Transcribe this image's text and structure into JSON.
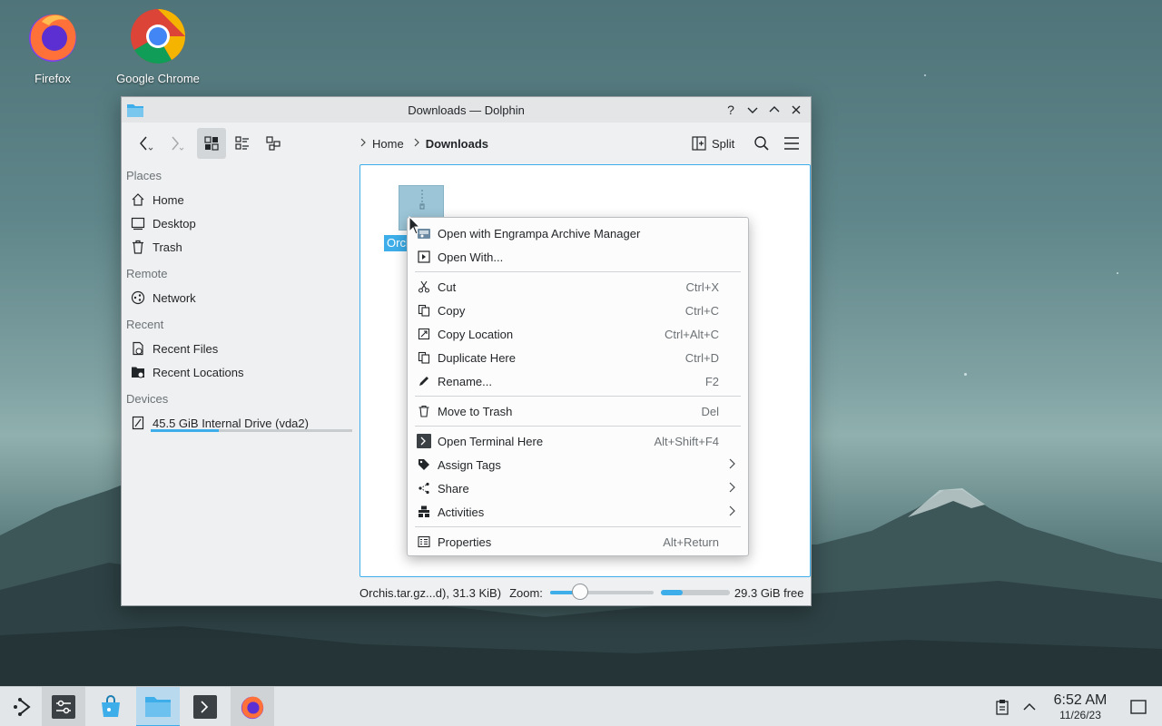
{
  "desktop": {
    "icons": [
      {
        "label": "Firefox",
        "icon": "firefox-icon"
      },
      {
        "label": "Google Chrome",
        "icon": "chrome-icon"
      }
    ]
  },
  "window": {
    "title": "Downloads — Dolphin",
    "title_buttons": {
      "help": "?",
      "minimize": "⌄",
      "maximize": "⌃",
      "close": "✕"
    }
  },
  "toolbar": {
    "breadcrumb": [
      {
        "label": "Home"
      },
      {
        "label": "Downloads"
      }
    ],
    "split_label": "Split"
  },
  "sidebar": {
    "sections": [
      {
        "title": "Places",
        "items": [
          "Home",
          "Desktop",
          "Trash"
        ]
      },
      {
        "title": "Remote",
        "items": [
          "Network"
        ]
      },
      {
        "title": "Recent",
        "items": [
          "Recent Files",
          "Recent Locations"
        ]
      },
      {
        "title": "Devices",
        "items": [
          "45.5 GiB Internal Drive (vda2)"
        ]
      }
    ],
    "drive_usage_fraction": 0.34
  },
  "file_view": {
    "file_label": "Orchis.tar.gz"
  },
  "statusbar": {
    "info": "Orchis.tar.gz...d), 31.3 KiB)",
    "zoom_label": "Zoom:",
    "free_space": "29.3 GiB free"
  },
  "context_menu": {
    "items": [
      {
        "label": "Open with Engrampa Archive Manager",
        "shortcut": "",
        "icon": "archive-icon"
      },
      {
        "label": "Open With...",
        "shortcut": "",
        "icon": "open-with-icon"
      },
      {
        "label": "Cut",
        "shortcut": "Ctrl+X",
        "icon": "scissors-icon"
      },
      {
        "label": "Copy",
        "shortcut": "Ctrl+C",
        "icon": "copy-icon"
      },
      {
        "label": "Copy Location",
        "shortcut": "Ctrl+Alt+C",
        "icon": "copy-location-icon"
      },
      {
        "label": "Duplicate Here",
        "shortcut": "Ctrl+D",
        "icon": "duplicate-icon"
      },
      {
        "label": "Rename...",
        "shortcut": "F2",
        "icon": "pencil-icon"
      },
      {
        "label": "Move to Trash",
        "shortcut": "Del",
        "icon": "trash-icon"
      },
      {
        "label": "Open Terminal Here",
        "shortcut": "Alt+Shift+F4",
        "icon": "terminal-icon"
      },
      {
        "label": "Assign Tags",
        "shortcut": "",
        "icon": "tag-icon"
      },
      {
        "label": "Share",
        "shortcut": "",
        "icon": "share-icon"
      },
      {
        "label": "Activities",
        "shortcut": "",
        "icon": "activities-icon"
      },
      {
        "label": "Properties",
        "shortcut": "Alt+Return",
        "icon": "properties-icon"
      }
    ]
  },
  "taskbar": {
    "time": "6:52 AM",
    "date": "11/26/23"
  },
  "colors": {
    "accent": "#3daee9",
    "window_bg": "#eff0f1"
  }
}
